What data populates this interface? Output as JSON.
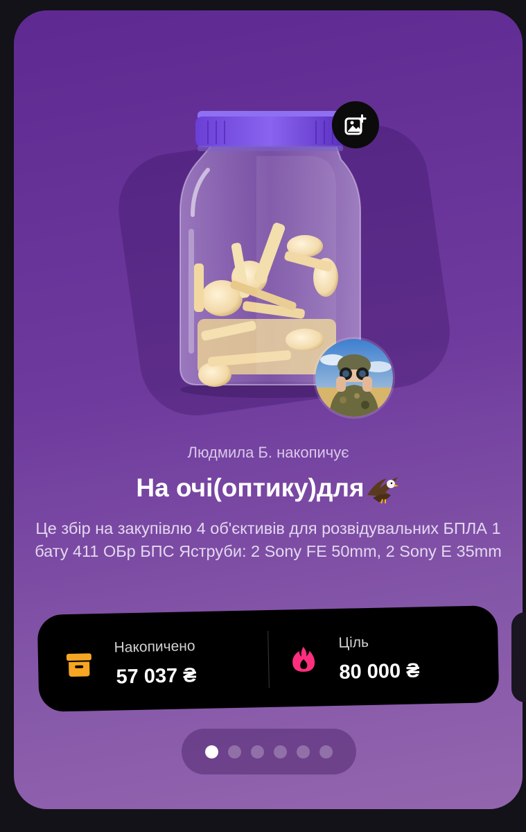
{
  "jar_card": {
    "owner_text": "Людмила Б. накопичує",
    "title": "На очі(оптику)для",
    "title_emoji": "eagle-emoji",
    "description": "Це збір на закупівлю 4 об'єктивів для розвідувальних БПЛА 1 бату 411 ОБр БПС Яструби: 2 Sony FE 50mm, 2 Sony E 35mm",
    "add_photo_icon": "add-photo-icon",
    "avatar": "soldier-with-binoculars"
  },
  "stats": {
    "accumulated_label": "Накопичено",
    "accumulated_value": "57 037 ₴",
    "accumulated_icon": "archive-box-icon",
    "goal_label": "Ціль",
    "goal_value": "80 000 ₴",
    "goal_icon": "fire-icon"
  },
  "pager": {
    "total": 6,
    "active": 1
  },
  "colors": {
    "card_gradient_top": "#5e2a92",
    "card_gradient_bottom": "#9465ae",
    "accumulated_icon": "#f6a623",
    "goal_icon": "#ff2e7e",
    "stats_background": "#000000"
  }
}
